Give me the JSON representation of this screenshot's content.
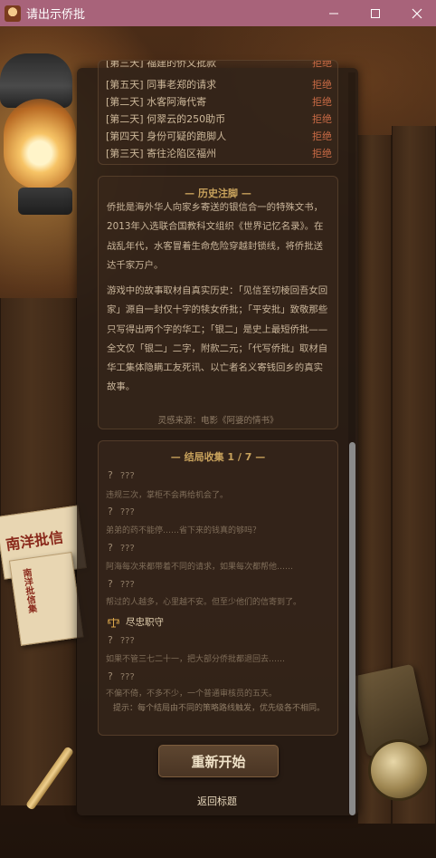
{
  "window": {
    "title": "请出示侨批"
  },
  "rejections": [
    {
      "text": "[第三天] 福建的侨文批款",
      "status": "拒绝"
    },
    {
      "text": "[第五天] 同事老郑的请求",
      "status": "拒绝"
    },
    {
      "text": "[第二天] 水客阿海代寄",
      "status": "拒绝"
    },
    {
      "text": "[第二天] 何翠云的250助币",
      "status": "拒绝"
    },
    {
      "text": "[第四天] 身份可疑的跑脚人",
      "status": "拒绝"
    },
    {
      "text": "[第三天] 寄往沦陷区福州",
      "status": "拒绝"
    }
  ],
  "history": {
    "title": "— 历史注脚 —",
    "para1": "侨批是海外华人向家乡寄送的银信合一的特殊文书，2013年入选联合国教科文组织《世界记忆名录》。在战乱年代，水客冒着生命危险穿越封锁线，将侨批送达千家万户。",
    "para2": "游戏中的故事取材自真实历史：「见信至切棱回吾女回家」源自一封仅十字的犊女侨批；「平安批」致敬那些只写得出两个字的华工；「银二」是史上最短侨批——全文仅「银二」二字，附款二元；「代写侨批」取材自华工集体隐瞒工友死讯、以亡者名义寄钱回乡的真实故事。",
    "source": "灵感来源：电影《阿婆的情书》"
  },
  "endings": {
    "title": "— 结局收集 1 / 7 —",
    "locked_label": "???",
    "locked": [
      {
        "hint": "违规三次，掌柜不会再给机会了。"
      },
      {
        "hint": "弟弟的药不能停……省下来的钱真的够吗？"
      },
      {
        "hint": "阿海每次来都带着不同的请求，如果每次都帮他……"
      },
      {
        "hint": "帮过的人越多，心里越不安。但至少他们的信寄到了。"
      },
      {
        "hint": "如果不管三七二十一，把大部分侨批都退回去……"
      },
      {
        "hint": "不偏不倚，不多不少，一个普通审核员的五天。"
      }
    ],
    "unlocked": {
      "label": "尽忠职守",
      "icon": "scales-icon"
    },
    "tip": "提示：每个结局由不同的策略路线触发，优先级各不相同。"
  },
  "buttons": {
    "restart": "重新开始",
    "back_to_title": "返回标题"
  },
  "props": {
    "letter_title": "南洋批信",
    "letter_small": "南洋批信集"
  },
  "colors": {
    "titlebar": "#a8637a",
    "reject": "#c86a45",
    "accent_gold": "#c8a25c"
  }
}
